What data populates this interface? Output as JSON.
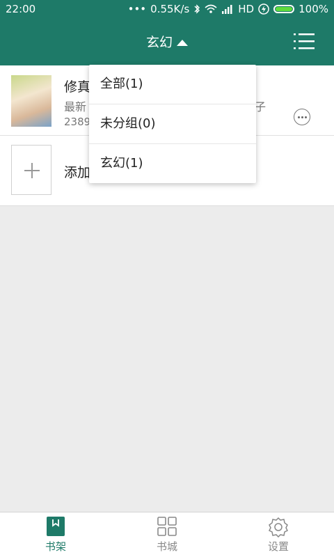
{
  "status_bar": {
    "time": "22:00",
    "dots": "•••",
    "network_speed": "0.55K/s",
    "hd": "HD",
    "battery": "100%"
  },
  "header": {
    "title": "玄幻"
  },
  "shelf": {
    "book": {
      "title": "修真",
      "subtitle": "最新",
      "subtitle_tail": "子",
      "count": "2389"
    },
    "add_label": "添加"
  },
  "dropdown": {
    "items": [
      {
        "label": "全部(1)"
      },
      {
        "label": "未分组(0)"
      },
      {
        "label": "玄幻(1)"
      }
    ]
  },
  "bottom_nav": {
    "tabs": [
      {
        "label": "书架"
      },
      {
        "label": "书城"
      },
      {
        "label": "设置"
      }
    ]
  },
  "colors": {
    "primary": "#1e7a68",
    "background": "#ececec"
  }
}
